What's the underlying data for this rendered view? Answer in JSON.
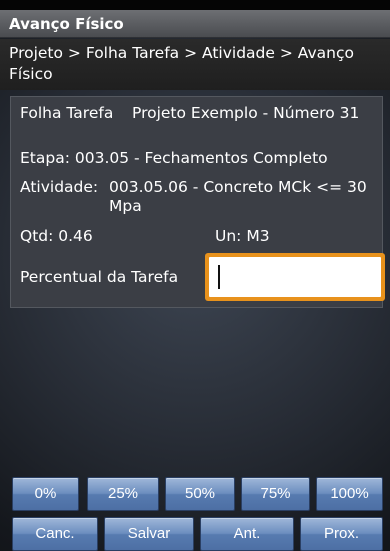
{
  "window": {
    "title": "Avanço Físico"
  },
  "breadcrumb": {
    "text": "Projeto > Folha Tarefa > Atividade > Avanço Físico"
  },
  "details": {
    "folha_label": "Folha Tarefa",
    "folha_value": "Projeto Exemplo - Número 31",
    "etapa": "Etapa: 003.05 - Fechamentos Completo",
    "atividade_label": "Atividade:",
    "atividade_value": "003.05.06 - Concreto MCk <= 30 Mpa",
    "qtd": "Qtd: 0.46",
    "un": "Un: M3",
    "percentual_label": "Percentual da Tarefa",
    "percentual_value": ""
  },
  "percent_buttons": [
    "0%",
    "25%",
    "50%",
    "75%",
    "100%"
  ],
  "nav_buttons": {
    "cancel": "Canc.",
    "save": "Salvar",
    "prev": "Ant.",
    "next": "Prox."
  },
  "colors": {
    "input_focus": "#e8921c",
    "button": "#6c8ebf"
  }
}
